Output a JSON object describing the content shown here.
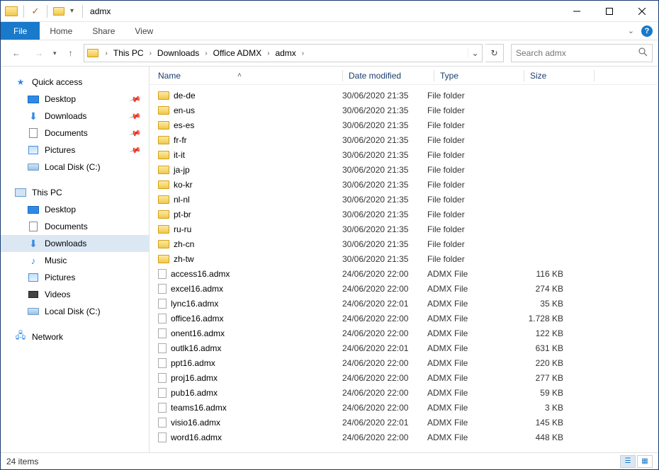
{
  "window": {
    "title": "admx"
  },
  "menubar": {
    "file": "File",
    "items": [
      "Home",
      "Share",
      "View"
    ]
  },
  "breadcrumbs": [
    "This PC",
    "Downloads",
    "Office ADMX",
    "admx"
  ],
  "search": {
    "placeholder": "Search admx"
  },
  "columns": {
    "name": "Name",
    "date": "Date modified",
    "type": "Type",
    "size": "Size"
  },
  "sidebar": {
    "quick_access": {
      "label": "Quick access",
      "items": [
        {
          "label": "Desktop",
          "pinned": true
        },
        {
          "label": "Downloads",
          "pinned": true
        },
        {
          "label": "Documents",
          "pinned": true
        },
        {
          "label": "Pictures",
          "pinned": true
        },
        {
          "label": "Local Disk (C:)",
          "pinned": false
        }
      ]
    },
    "this_pc": {
      "label": "This PC",
      "items": [
        {
          "label": "Desktop"
        },
        {
          "label": "Documents"
        },
        {
          "label": "Downloads",
          "selected": true
        },
        {
          "label": "Music"
        },
        {
          "label": "Pictures"
        },
        {
          "label": "Videos"
        },
        {
          "label": "Local Disk (C:)"
        }
      ]
    },
    "network": {
      "label": "Network"
    }
  },
  "files": [
    {
      "name": "de-de",
      "date": "30/06/2020 21:35",
      "type": "File folder",
      "size": "",
      "icon": "folder"
    },
    {
      "name": "en-us",
      "date": "30/06/2020 21:35",
      "type": "File folder",
      "size": "",
      "icon": "folder"
    },
    {
      "name": "es-es",
      "date": "30/06/2020 21:35",
      "type": "File folder",
      "size": "",
      "icon": "folder"
    },
    {
      "name": "fr-fr",
      "date": "30/06/2020 21:35",
      "type": "File folder",
      "size": "",
      "icon": "folder"
    },
    {
      "name": "it-it",
      "date": "30/06/2020 21:35",
      "type": "File folder",
      "size": "",
      "icon": "folder"
    },
    {
      "name": "ja-jp",
      "date": "30/06/2020 21:35",
      "type": "File folder",
      "size": "",
      "icon": "folder"
    },
    {
      "name": "ko-kr",
      "date": "30/06/2020 21:35",
      "type": "File folder",
      "size": "",
      "icon": "folder"
    },
    {
      "name": "nl-nl",
      "date": "30/06/2020 21:35",
      "type": "File folder",
      "size": "",
      "icon": "folder"
    },
    {
      "name": "pt-br",
      "date": "30/06/2020 21:35",
      "type": "File folder",
      "size": "",
      "icon": "folder"
    },
    {
      "name": "ru-ru",
      "date": "30/06/2020 21:35",
      "type": "File folder",
      "size": "",
      "icon": "folder"
    },
    {
      "name": "zh-cn",
      "date": "30/06/2020 21:35",
      "type": "File folder",
      "size": "",
      "icon": "folder"
    },
    {
      "name": "zh-tw",
      "date": "30/06/2020 21:35",
      "type": "File folder",
      "size": "",
      "icon": "folder"
    },
    {
      "name": "access16.admx",
      "date": "24/06/2020 22:00",
      "type": "ADMX File",
      "size": "116 KB",
      "icon": "file"
    },
    {
      "name": "excel16.admx",
      "date": "24/06/2020 22:00",
      "type": "ADMX File",
      "size": "274 KB",
      "icon": "file"
    },
    {
      "name": "lync16.admx",
      "date": "24/06/2020 22:01",
      "type": "ADMX File",
      "size": "35 KB",
      "icon": "file"
    },
    {
      "name": "office16.admx",
      "date": "24/06/2020 22:00",
      "type": "ADMX File",
      "size": "1.728 KB",
      "icon": "file"
    },
    {
      "name": "onent16.admx",
      "date": "24/06/2020 22:00",
      "type": "ADMX File",
      "size": "122 KB",
      "icon": "file"
    },
    {
      "name": "outlk16.admx",
      "date": "24/06/2020 22:01",
      "type": "ADMX File",
      "size": "631 KB",
      "icon": "file"
    },
    {
      "name": "ppt16.admx",
      "date": "24/06/2020 22:00",
      "type": "ADMX File",
      "size": "220 KB",
      "icon": "file"
    },
    {
      "name": "proj16.admx",
      "date": "24/06/2020 22:00",
      "type": "ADMX File",
      "size": "277 KB",
      "icon": "file"
    },
    {
      "name": "pub16.admx",
      "date": "24/06/2020 22:00",
      "type": "ADMX File",
      "size": "59 KB",
      "icon": "file"
    },
    {
      "name": "teams16.admx",
      "date": "24/06/2020 22:00",
      "type": "ADMX File",
      "size": "3 KB",
      "icon": "file"
    },
    {
      "name": "visio16.admx",
      "date": "24/06/2020 22:01",
      "type": "ADMX File",
      "size": "145 KB",
      "icon": "file"
    },
    {
      "name": "word16.admx",
      "date": "24/06/2020 22:00",
      "type": "ADMX File",
      "size": "448 KB",
      "icon": "file"
    }
  ],
  "status": {
    "count": "24 items"
  }
}
